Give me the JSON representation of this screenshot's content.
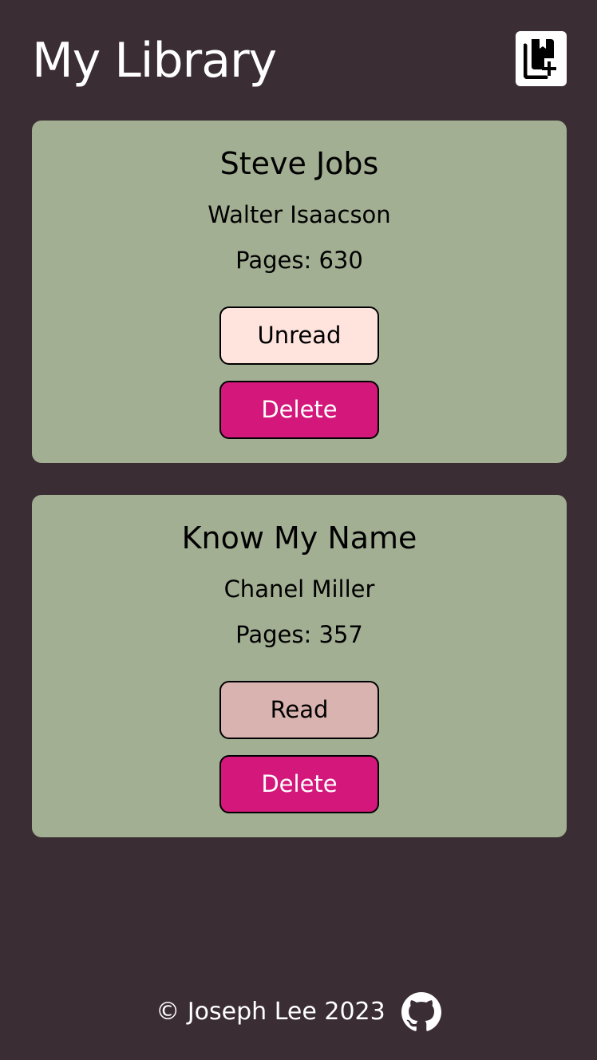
{
  "header": {
    "title": "My Library",
    "add_button_icon": "add-book-icon"
  },
  "books": [
    {
      "title": "Steve Jobs",
      "author": "Walter Isaacson",
      "pages": "Pages: 630",
      "status_label": "Unread",
      "delete_label": "Delete"
    },
    {
      "title": "Know My Name",
      "author": "Chanel Miller",
      "pages": "Pages: 357",
      "status_label": "Read",
      "delete_label": "Delete"
    }
  ],
  "footer": {
    "copyright": "© Joseph Lee 2023",
    "github_icon": "github-icon"
  },
  "colors": {
    "background": "#3a2d33",
    "card": "#a3af93",
    "unread_button": "#ffe4de",
    "read_button": "#d9b3af",
    "delete_button": "#d3177b"
  }
}
